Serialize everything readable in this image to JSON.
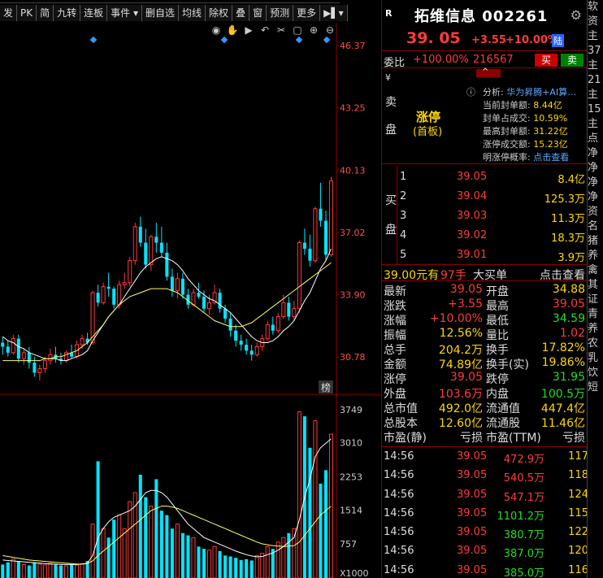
{
  "toolbar": {
    "items": [
      "发",
      "PK",
      "简",
      "九转",
      "连板",
      "事件 ▾",
      "删自选",
      "均线",
      "除权",
      "叠",
      "窗",
      "预测",
      "更多",
      "▶▌▾"
    ]
  },
  "chart": {
    "price_ticks": [
      "46.37",
      "43.25",
      "40.13",
      "37.02",
      "33.90",
      "30.78"
    ],
    "volume_ticks": [
      "3749",
      "3010",
      "2253",
      "1514",
      "757",
      "X1000"
    ],
    "rank_badge": "榜",
    "colors": {
      "up": "#ff3b3b",
      "down": "#00e5ff",
      "ma1": "#ffffff",
      "ma2": "#ffff66",
      "axis_text": "#ff4d4d",
      "vol_axis_text": "#cccccc"
    }
  },
  "chart_data": {
    "type": "candlestick",
    "ylim": [
      29.0,
      47.5
    ],
    "candles": [
      [
        31.5,
        31.8,
        30.9,
        31.3
      ],
      [
        31.3,
        31.6,
        30.8,
        31.0
      ],
      [
        31.0,
        31.9,
        30.9,
        31.7
      ],
      [
        31.7,
        31.9,
        30.5,
        30.7
      ],
      [
        30.7,
        31.2,
        30.4,
        31.0
      ],
      [
        31.0,
        31.3,
        30.2,
        30.5
      ],
      [
        30.5,
        30.8,
        29.8,
        30.0
      ],
      [
        30.0,
        30.4,
        29.6,
        30.2
      ],
      [
        30.2,
        30.8,
        30.0,
        30.6
      ],
      [
        30.6,
        31.2,
        30.4,
        30.9
      ],
      [
        30.9,
        31.3,
        30.5,
        30.7
      ],
      [
        30.7,
        31.0,
        30.4,
        30.6
      ],
      [
        30.6,
        31.1,
        30.5,
        31.0
      ],
      [
        31.0,
        31.4,
        30.7,
        30.8
      ],
      [
        30.8,
        31.6,
        30.7,
        31.4
      ],
      [
        31.4,
        31.9,
        31.2,
        31.7
      ],
      [
        31.7,
        32.0,
        31.4,
        31.5
      ],
      [
        31.5,
        34.1,
        31.4,
        34.0
      ],
      [
        34.0,
        34.4,
        33.3,
        33.5
      ],
      [
        33.5,
        34.5,
        33.4,
        34.3
      ],
      [
        34.3,
        35.0,
        33.8,
        34.2
      ],
      [
        34.2,
        34.3,
        33.2,
        33.4
      ],
      [
        33.4,
        34.6,
        33.2,
        34.4
      ],
      [
        34.4,
        35.0,
        34.2,
        34.5
      ],
      [
        34.5,
        35.8,
        34.3,
        35.6
      ],
      [
        35.6,
        37.5,
        35.4,
        37.3
      ],
      [
        37.3,
        37.8,
        36.3,
        36.5
      ],
      [
        36.5,
        37.2,
        35.2,
        35.4
      ],
      [
        35.4,
        36.9,
        35.1,
        36.8
      ],
      [
        36.8,
        37.5,
        36.0,
        36.5
      ],
      [
        36.5,
        37.3,
        35.8,
        36.0
      ],
      [
        36.0,
        36.5,
        34.6,
        34.8
      ],
      [
        34.8,
        35.2,
        33.8,
        34.1
      ],
      [
        34.1,
        35.0,
        33.7,
        34.7
      ],
      [
        34.7,
        35.0,
        33.7,
        33.9
      ],
      [
        33.9,
        34.2,
        33.2,
        33.4
      ],
      [
        33.4,
        34.2,
        33.3,
        34.0
      ],
      [
        34.0,
        34.5,
        33.7,
        33.8
      ],
      [
        33.8,
        34.1,
        33.0,
        33.2
      ],
      [
        33.2,
        33.9,
        32.9,
        33.5
      ],
      [
        33.5,
        34.4,
        33.4,
        34.0
      ],
      [
        34.0,
        34.2,
        33.0,
        33.2
      ],
      [
        33.2,
        33.4,
        32.5,
        32.7
      ],
      [
        32.7,
        33.0,
        31.8,
        32.1
      ],
      [
        32.1,
        32.4,
        31.3,
        31.6
      ],
      [
        31.6,
        31.9,
        31.1,
        31.4
      ],
      [
        31.4,
        31.7,
        30.9,
        31.1
      ],
      [
        31.1,
        31.4,
        30.6,
        30.9
      ],
      [
        30.9,
        31.5,
        30.8,
        31.3
      ],
      [
        31.3,
        31.9,
        31.1,
        31.7
      ],
      [
        31.7,
        32.6,
        31.6,
        32.4
      ],
      [
        32.4,
        32.8,
        31.9,
        32.1
      ],
      [
        32.1,
        33.0,
        32.0,
        32.8
      ],
      [
        32.8,
        33.9,
        32.7,
        33.5
      ],
      [
        33.5,
        33.8,
        32.6,
        32.8
      ],
      [
        32.8,
        33.6,
        32.6,
        33.2
      ],
      [
        33.2,
        36.6,
        33.0,
        36.5
      ],
      [
        36.5,
        37.2,
        35.9,
        36.2
      ],
      [
        36.2,
        36.9,
        35.3,
        35.6
      ],
      [
        35.6,
        38.3,
        35.5,
        38.2
      ],
      [
        38.2,
        39.5,
        37.3,
        37.6
      ],
      [
        37.6,
        38.1,
        35.6,
        35.9
      ],
      [
        35.9,
        39.8,
        35.8,
        39.6
      ]
    ],
    "ma1": [
      31.8,
      31.6,
      31.5,
      31.3,
      31.2,
      31.0,
      30.9,
      30.8,
      30.7,
      30.7,
      30.7,
      30.6,
      30.6,
      30.7,
      30.8,
      30.9,
      31.1,
      31.6,
      32.0,
      32.4,
      32.8,
      33.1,
      33.4,
      33.8,
      34.2,
      34.6,
      35.0,
      35.3,
      35.5,
      35.7,
      35.8,
      35.7,
      35.6,
      35.4,
      35.1,
      34.7,
      34.4,
      34.1,
      33.9,
      33.7,
      33.6,
      33.4,
      33.2,
      33.0,
      32.7,
      32.4,
      32.1,
      31.8,
      31.6,
      31.5,
      31.5,
      31.6,
      31.8,
      32.1,
      32.3,
      32.6,
      33.1,
      33.6,
      34.0,
      34.6,
      35.2,
      35.6,
      36.2
    ],
    "ma2": [
      30.6,
      30.6,
      30.6,
      30.6,
      30.6,
      30.6,
      30.6,
      30.6,
      30.7,
      30.7,
      30.8,
      30.8,
      30.9,
      31.0,
      31.1,
      31.3,
      31.5,
      31.8,
      32.1,
      32.4,
      32.8,
      33.1,
      33.4,
      33.6,
      33.8,
      33.9,
      34.0,
      34.1,
      34.2,
      34.2,
      34.2,
      34.2,
      34.1,
      34.0,
      33.8,
      33.6,
      33.4,
      33.2,
      33.0,
      32.8,
      32.6,
      32.5,
      32.4,
      32.3,
      32.3,
      32.3,
      32.4,
      32.5,
      32.7,
      32.9,
      33.1,
      33.3,
      33.5,
      33.7,
      33.9,
      34.1,
      34.3,
      34.5,
      34.7,
      34.9,
      35.1,
      35.3,
      35.5
    ],
    "volume_ylim": [
      0,
      4000
    ],
    "volume": [
      300,
      350,
      420,
      380,
      300,
      280,
      350,
      310,
      290,
      330,
      300,
      280,
      270,
      300,
      290,
      320,
      380,
      1200,
      2600,
      1100,
      900,
      1300,
      1400,
      1100,
      1700,
      1900,
      2300,
      1800,
      1600,
      2200,
      1500,
      1400,
      1100,
      1200,
      1000,
      950,
      900,
      700,
      650,
      620,
      700,
      600,
      500,
      480,
      450,
      400,
      420,
      390,
      500,
      550,
      700,
      650,
      800,
      900,
      1000,
      1100,
      3700,
      3600,
      2900,
      3500,
      2100,
      2400,
      3200
    ],
    "vol_ma1": [
      400,
      390,
      380,
      370,
      360,
      350,
      340,
      330,
      320,
      310,
      310,
      300,
      300,
      300,
      300,
      310,
      330,
      500,
      900,
      1100,
      1250,
      1350,
      1400,
      1450,
      1500,
      1600,
      1750,
      1900,
      1950,
      1950,
      1900,
      1800,
      1650,
      1500,
      1350,
      1200,
      1100,
      1000,
      900,
      850,
      800,
      750,
      700,
      650,
      600,
      560,
      520,
      490,
      470,
      480,
      520,
      560,
      620,
      700,
      800,
      900,
      1300,
      1800,
      2200,
      2700,
      2900,
      3000,
      3100
    ],
    "vol_ma2": [
      500,
      480,
      460,
      440,
      420,
      400,
      390,
      380,
      370,
      360,
      350,
      340,
      330,
      320,
      310,
      310,
      320,
      380,
      500,
      600,
      700,
      800,
      900,
      1000,
      1100,
      1200,
      1300,
      1400,
      1500,
      1550,
      1600,
      1600,
      1580,
      1550,
      1500,
      1450,
      1400,
      1350,
      1300,
      1250,
      1200,
      1150,
      1100,
      1050,
      1000,
      950,
      900,
      850,
      800,
      760,
      740,
      720,
      710,
      700,
      710,
      720,
      800,
      950,
      1100,
      1250,
      1400,
      1500,
      1600
    ]
  },
  "header": {
    "badge": "R",
    "name": "拓维信息 002261",
    "price": "39. 05",
    "change": "+3.55",
    "change_pct": "+10.00%",
    "lu": "陆"
  },
  "weibi": {
    "label": "委比",
    "pct": "+100.00%",
    "value": "216567",
    "buy_btn": "买",
    "sell_btn": "卖"
  },
  "sell_panel": {
    "vertical": [
      "卖",
      "盘"
    ],
    "yen_mark": "¥",
    "status": "涨停",
    "status_sub": "(首板)",
    "analysis_label": "分析:",
    "analysis_value": "华为昇腾+AI算…",
    "rows": [
      {
        "label": "当前封单额:",
        "value": "8.44亿"
      },
      {
        "label": "封单占成交:",
        "value": "10.59%"
      },
      {
        "label": "最高封单额:",
        "value": "31.22亿"
      },
      {
        "label": "涨停成交额:",
        "value": "15.23亿"
      },
      {
        "label": "明涨停概率:",
        "value": "点击查看"
      }
    ]
  },
  "buy_panel": {
    "vertical": [
      "买",
      "盘"
    ],
    "rows": [
      {
        "n": "1",
        "price": "39.05",
        "vol": "8.4亿"
      },
      {
        "n": "2",
        "price": "39.04",
        "vol": "125.3万"
      },
      {
        "n": "3",
        "price": "39.03",
        "vol": "11.3万"
      },
      {
        "n": "4",
        "price": "39.02",
        "vol": "18.3万"
      },
      {
        "n": "5",
        "price": "39.01",
        "vol": "3.9万"
      }
    ]
  },
  "summary": {
    "price": "39.00元有",
    "hands": "97手",
    "big": "大买单",
    "link": "点击查看"
  },
  "stats": [
    {
      "l1": "最新",
      "v1": "39.05",
      "c1": "red",
      "l2": "开盘",
      "v2": "34.88",
      "c2": "yel"
    },
    {
      "l1": "涨跌",
      "v1": "+3.55",
      "c1": "red",
      "l2": "最高",
      "v2": "39.05",
      "c2": "red"
    },
    {
      "l1": "涨幅",
      "v1": "+10.00%",
      "c1": "red",
      "l2": "最低",
      "v2": "34.59",
      "c2": "green"
    },
    {
      "l1": "振幅",
      "v1": "12.56%",
      "c1": "yel",
      "l2": "量比",
      "v2": "1.02",
      "c2": "red"
    },
    {
      "l1": "总手",
      "v1": "204.2万",
      "c1": "yel",
      "l2": "换手",
      "v2": "17.82%",
      "c2": "yel"
    },
    {
      "l1": "金额",
      "v1": "74.89亿",
      "c1": "yel",
      "l2": "换手(实)",
      "v2": "19.86%",
      "c2": "yel"
    },
    {
      "l1": "涨停",
      "v1": "39.05",
      "c1": "red",
      "l2": "跌停",
      "v2": "31.95",
      "c2": "green"
    },
    {
      "l1": "外盘",
      "v1": "103.6万",
      "c1": "red",
      "l2": "内盘",
      "v2": "100.5万",
      "c2": "green"
    },
    {
      "l1": "总市值",
      "v1": "492.0亿",
      "c1": "yel",
      "l2": "流通值",
      "v2": "447.4亿",
      "c2": "yel"
    },
    {
      "l1": "总股本",
      "v1": "12.60亿",
      "c1": "yel",
      "l2": "流通股",
      "v2": "11.46亿",
      "c2": "yel"
    },
    {
      "l1": "市盈(静)",
      "v1": "亏损",
      "c1": "wht",
      "l2": "市盈(TTM)",
      "v2": "亏损",
      "c2": "wht"
    }
  ],
  "ticks": [
    {
      "t": "14:56",
      "p": "39.05",
      "v": "472.9万",
      "vc": "red",
      "n": "117"
    },
    {
      "t": "14:56",
      "p": "39.05",
      "v": "540.5万",
      "vc": "red",
      "n": "118"
    },
    {
      "t": "14:56",
      "p": "39.05",
      "v": "547.1万",
      "vc": "red",
      "n": "124"
    },
    {
      "t": "14:56",
      "p": "39.05",
      "v": "1101.2万",
      "vc": "green",
      "n": "115"
    },
    {
      "t": "14:56",
      "p": "39.05",
      "v": "380.7万",
      "vc": "green",
      "n": "122"
    },
    {
      "t": "14:56",
      "p": "39.05",
      "v": "387.0万",
      "vc": "green",
      "n": "120"
    },
    {
      "t": "14:56",
      "p": "39.05",
      "v": "385.0万",
      "vc": "green",
      "n": "116"
    }
  ],
  "far_right": [
    "软",
    "资",
    "主",
    "37",
    "主",
    "21",
    "主",
    "15",
    "主",
    "点",
    "净",
    "净",
    "净",
    "净",
    "资",
    "名",
    "猪",
    "养",
    "禽",
    "其",
    "证",
    "青",
    "养",
    "农",
    "乳",
    "饮",
    "短"
  ]
}
